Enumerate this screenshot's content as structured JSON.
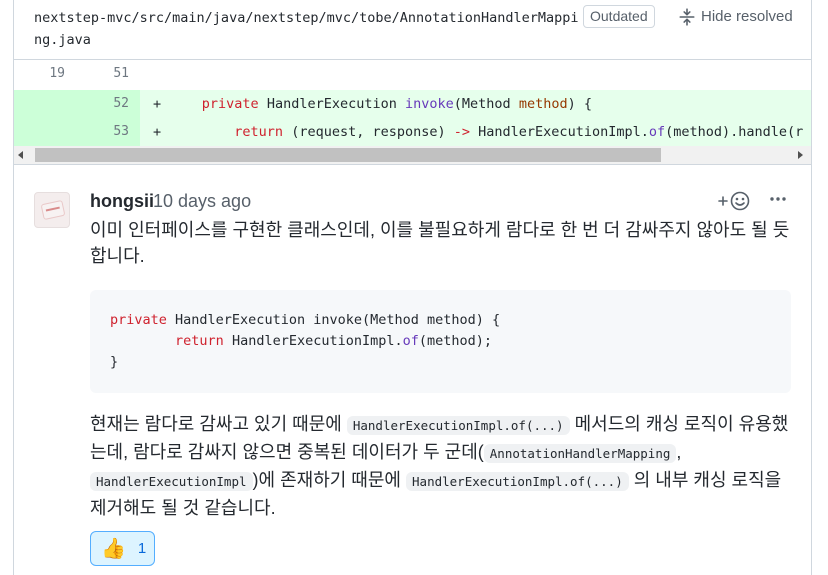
{
  "file": {
    "path": "nextstep-mvc/src/main/java/nextstep/mvc/tobe/AnnotationHandlerMapping.java",
    "outdated_label": "Outdated",
    "hide_resolved_label": "Hide resolved"
  },
  "diff": {
    "context_row": {
      "old_line": "19",
      "new_line": "51"
    },
    "added_rows": [
      {
        "new_line": "52",
        "marker": "+"
      },
      {
        "new_line": "53",
        "marker": "+"
      }
    ],
    "colors": {
      "added_number_bg": "#ccffd8",
      "added_code_bg": "#e6ffec"
    }
  },
  "comment": {
    "author": "hongsii",
    "time": "10 days ago",
    "paragraph1": "이미 인터페이스를 구현한 클래스인데, 이를 불필요하게 람다로 한 번 더 감싸주지 않아도 될 듯 합니다.",
    "paragraph2": {
      "t1": "현재는 람다로 감싸고 있기 때문에",
      "c1": "HandlerExecutionImpl.of(...)",
      "t2": "메서드의 캐싱 로직이 유용했는데, 람다로 감싸지 않으면 중복된 데이터가 두 군데(",
      "c2": "AnnotationHandlerMapping",
      "t3": ",",
      "c3": "HandlerExecutionImpl",
      "t4": ")에 존재하기 때문에",
      "c4": "HandlerExecutionImpl.of(...)",
      "t5": "의 내부 캐싱 로직을 제거해도 될 것 같습니다."
    },
    "reaction": {
      "emoji": "👍",
      "count": "1"
    },
    "react_icon": "smiley-plus-icon",
    "more_icon": "kebab-horizontal-icon"
  }
}
